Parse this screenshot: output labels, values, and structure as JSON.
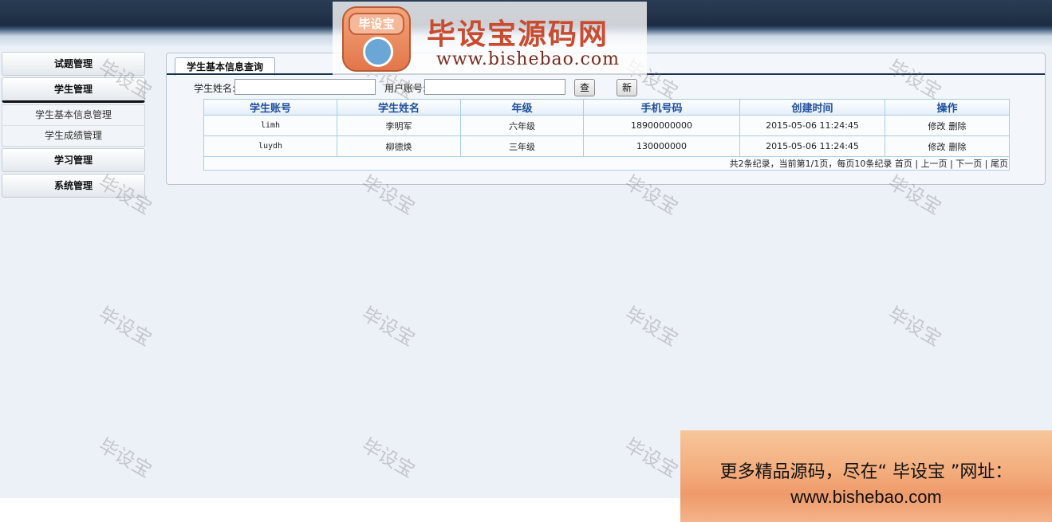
{
  "logo": {
    "badge": "毕设宝",
    "title": "毕设宝源码网",
    "url": "www.bishebao.com"
  },
  "sidebar": {
    "items": [
      {
        "label": "试题管理"
      },
      {
        "label": "学生管理"
      },
      {
        "label": "学习管理"
      },
      {
        "label": "系统管理"
      }
    ],
    "sub_items": [
      {
        "label": "学生基本信息管理"
      },
      {
        "label": "学生成绩管理"
      }
    ]
  },
  "tab": {
    "label": "学生基本信息查询"
  },
  "search": {
    "name_label": "学生姓名:",
    "name_value": "",
    "account_label": "用户账号:",
    "account_value": "",
    "query_button": "查询",
    "add_button": "新增"
  },
  "table": {
    "columns": [
      "学生账号",
      "学生姓名",
      "年级",
      "手机号码",
      "创建时间",
      "操作"
    ],
    "rows": [
      {
        "account": "limh",
        "name": "李明军",
        "grade": "六年级",
        "phone": "18900000000",
        "created": "2015-05-06 11:24:45",
        "edit": "修改",
        "delete": "删除"
      },
      {
        "account": "luydh",
        "name": "柳德焕",
        "grade": "三年级",
        "phone": "130000000",
        "created": "2015-05-06 11:24:45",
        "edit": "修改",
        "delete": "删除"
      }
    ],
    "pager": {
      "summary": "共2条纪录，当前第1/1页，每页10条纪录",
      "first": "首页",
      "prev": "上一页",
      "next": "下一页",
      "last": "尾页",
      "sep": "|"
    }
  },
  "watermark": {
    "text": "毕设宝"
  },
  "promo": {
    "line1": "更多精品源码，尽在“ 毕设宝 ”网址：",
    "line2": "www.bishebao.com"
  }
}
